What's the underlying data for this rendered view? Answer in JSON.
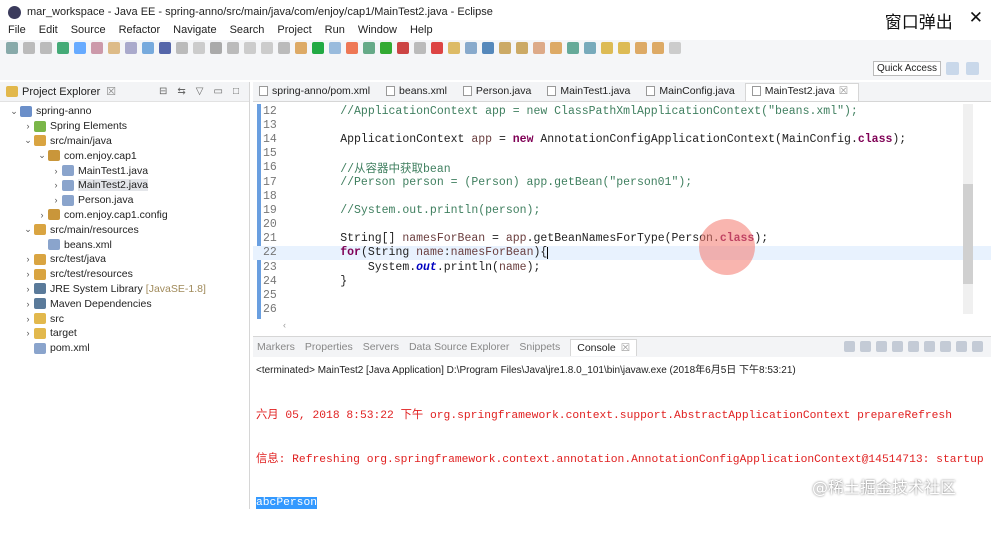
{
  "window": {
    "title": "mar_workspace - Java EE - spring-anno/src/main/java/com/enjoy/cap1/MainTest2.java - Eclipse",
    "popout_label": "窗口弹出",
    "close": "✕"
  },
  "menu": [
    "File",
    "Edit",
    "Source",
    "Refactor",
    "Navigate",
    "Search",
    "Project",
    "Run",
    "Window",
    "Help"
  ],
  "toolbar": {
    "quick_access": "Quick Access"
  },
  "project_explorer": {
    "title": "Project Explorer",
    "close": "☒",
    "items": [
      {
        "label": "spring-anno",
        "depth": 0,
        "arrow": "⌄",
        "icon": "project-icon",
        "color": "#6b8fc9"
      },
      {
        "label": "Spring Elements",
        "depth": 1,
        "arrow": "›",
        "icon": "spring-leaf-icon",
        "color": "#7ab648"
      },
      {
        "label": "src/main/java",
        "depth": 1,
        "arrow": "⌄",
        "icon": "source-folder-icon",
        "color": "#d9a441"
      },
      {
        "label": "com.enjoy.cap1",
        "depth": 2,
        "arrow": "⌄",
        "icon": "package-icon",
        "color": "#c9963a"
      },
      {
        "label": "MainTest1.java",
        "depth": 3,
        "arrow": "›",
        "icon": "java-file-icon",
        "color": "#8aa4cc"
      },
      {
        "label": "MainTest2.java",
        "depth": 3,
        "arrow": "›",
        "icon": "java-file-icon",
        "color": "#8aa4cc",
        "selected": true
      },
      {
        "label": "Person.java",
        "depth": 3,
        "arrow": "›",
        "icon": "java-file-icon",
        "color": "#8aa4cc"
      },
      {
        "label": "com.enjoy.cap1.config",
        "depth": 2,
        "arrow": "›",
        "icon": "package-icon",
        "color": "#c9963a"
      },
      {
        "label": "src/main/resources",
        "depth": 1,
        "arrow": "⌄",
        "icon": "source-folder-icon",
        "color": "#d9a441"
      },
      {
        "label": "beans.xml",
        "depth": 2,
        "arrow": "",
        "icon": "xml-file-icon",
        "color": "#8aa4cc"
      },
      {
        "label": "src/test/java",
        "depth": 1,
        "arrow": "›",
        "icon": "source-folder-icon",
        "color": "#d9a441"
      },
      {
        "label": "src/test/resources",
        "depth": 1,
        "arrow": "›",
        "icon": "source-folder-icon",
        "color": "#d9a441"
      },
      {
        "label": "JRE System Library",
        "decoration": "[JavaSE-1.8]",
        "depth": 1,
        "arrow": "›",
        "icon": "library-icon",
        "color": "#5a7a9a"
      },
      {
        "label": "Maven Dependencies",
        "depth": 1,
        "arrow": "›",
        "icon": "library-icon",
        "color": "#5a7a9a"
      },
      {
        "label": "src",
        "depth": 1,
        "arrow": "›",
        "icon": "folder-icon",
        "color": "#e2b84c"
      },
      {
        "label": "target",
        "depth": 1,
        "arrow": "›",
        "icon": "folder-icon",
        "color": "#e2b84c"
      },
      {
        "label": "pom.xml",
        "depth": 1,
        "arrow": "",
        "icon": "maven-file-icon",
        "color": "#8aa4cc"
      }
    ]
  },
  "editor": {
    "tabs": [
      {
        "label": "spring-anno/pom.xml"
      },
      {
        "label": "beans.xml"
      },
      {
        "label": "Person.java"
      },
      {
        "label": "MainTest1.java"
      },
      {
        "label": "MainConfig.java"
      },
      {
        "label": "MainTest2.java",
        "active": true,
        "close": "☒"
      }
    ],
    "lines": [
      {
        "n": "12",
        "seg": [
          {
            "t": "        //ApplicationContext app = new ClassPathXmlApplicationContext(\"beans.xml\");",
            "c": "cm"
          }
        ]
      },
      {
        "n": "13",
        "seg": []
      },
      {
        "n": "14",
        "seg": [
          {
            "t": "        ApplicationContext ",
            "c": ""
          },
          {
            "t": "app",
            "c": "var"
          },
          {
            "t": " = ",
            "c": ""
          },
          {
            "t": "new",
            "c": "kw"
          },
          {
            "t": " AnnotationConfigApplicationContext(MainConfig.",
            "c": ""
          },
          {
            "t": "class",
            "c": "kw"
          },
          {
            "t": ");",
            "c": ""
          }
        ]
      },
      {
        "n": "15",
        "seg": []
      },
      {
        "n": "16",
        "seg": [
          {
            "t": "        //从容器中获取bean",
            "c": "cm"
          }
        ]
      },
      {
        "n": "17",
        "seg": [
          {
            "t": "        //Person person = (Person) app.getBean(\"person01\");",
            "c": "cm"
          }
        ]
      },
      {
        "n": "18",
        "seg": []
      },
      {
        "n": "19",
        "seg": [
          {
            "t": "        //System.out.println(person);",
            "c": "cm"
          }
        ]
      },
      {
        "n": "20",
        "seg": []
      },
      {
        "n": "21",
        "seg": [
          {
            "t": "        String[] ",
            "c": ""
          },
          {
            "t": "namesForBean",
            "c": "var"
          },
          {
            "t": " = ",
            "c": ""
          },
          {
            "t": "app",
            "c": "var"
          },
          {
            "t": ".getBeanNamesForType(Person.",
            "c": ""
          },
          {
            "t": "class",
            "c": "kw"
          },
          {
            "t": ");",
            "c": ""
          }
        ]
      },
      {
        "n": "22",
        "current": true,
        "seg": [
          {
            "t": "        ",
            "c": ""
          },
          {
            "t": "for",
            "c": "kw"
          },
          {
            "t": "(String ",
            "c": ""
          },
          {
            "t": "name",
            "c": "var"
          },
          {
            "t": ":",
            "c": ""
          },
          {
            "t": "namesForBean",
            "c": "var"
          },
          {
            "t": "){",
            "c": ""
          }
        ]
      },
      {
        "n": "23",
        "seg": [
          {
            "t": "            System.",
            "c": ""
          },
          {
            "t": "out",
            "c": "fld"
          },
          {
            "t": ".println(",
            "c": ""
          },
          {
            "t": "name",
            "c": "var"
          },
          {
            "t": ");",
            "c": ""
          }
        ]
      },
      {
        "n": "24",
        "seg": [
          {
            "t": "        }",
            "c": ""
          }
        ]
      },
      {
        "n": "25",
        "seg": []
      },
      {
        "n": "26",
        "seg": []
      }
    ]
  },
  "console": {
    "tabs": [
      "Markers",
      "Properties",
      "Servers",
      "Data Source Explorer",
      "Snippets"
    ],
    "active_tab": "Console",
    "close": "☒",
    "status": "<terminated> MainTest2 [Java Application] D:\\Program Files\\Java\\jre1.8.0_101\\bin\\javaw.exe (2018年6月5日 下午8:53:21)",
    "output": [
      "六月 05, 2018 8:53:22 下午 org.springframework.context.support.AbstractApplicationContext prepareRefresh",
      "信息: Refreshing org.springframework.context.annotation.AnnotationConfigApplicationContext@14514713: startup"
    ],
    "selected_output": "abcPerson"
  },
  "watermark": "@稀土掘金技术社区"
}
